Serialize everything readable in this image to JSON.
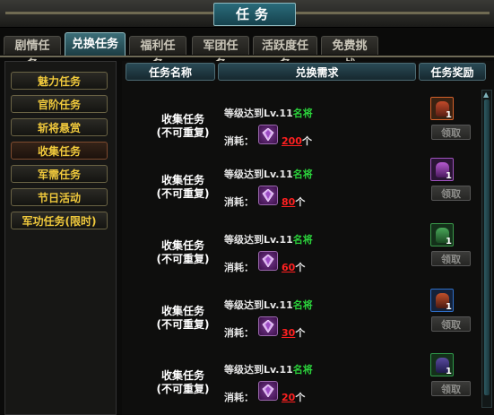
{
  "window": {
    "title": "任务"
  },
  "tabs": [
    {
      "label": "剧情任务",
      "active": false
    },
    {
      "label": "兑换任务",
      "active": true
    },
    {
      "label": "福利任务",
      "active": false
    },
    {
      "label": "军团任务",
      "active": false
    },
    {
      "label": "活跃度任务",
      "active": false
    },
    {
      "label": "免费挑战",
      "active": false
    }
  ],
  "sidebar": {
    "items": [
      {
        "label": "魅力任务",
        "active": false
      },
      {
        "label": "官阶任务",
        "active": false
      },
      {
        "label": "斩将悬赏",
        "active": false
      },
      {
        "label": "收集任务",
        "active": true
      },
      {
        "label": "军需任务",
        "active": false
      },
      {
        "label": "节日活动",
        "active": false
      },
      {
        "label": "军功任务(限时)",
        "active": false
      }
    ]
  },
  "table": {
    "headers": {
      "name": "任务名称",
      "requirement": "兑换需求",
      "reward": "任务奖励"
    },
    "rows": [
      {
        "name": "收集任务",
        "sub": "(不可重复)",
        "req_prefix": "等级达到Lv.11",
        "req_green": "名将",
        "cost_label": "消耗：",
        "cost_value": "200",
        "cost_unit": "个",
        "reward_count": "1",
        "claim_label": "领取",
        "reward_color": "#d5612a"
      },
      {
        "name": "收集任务",
        "sub": "(不可重复)",
        "req_prefix": "等级达到Lv.11",
        "req_green": "名将",
        "cost_label": "消耗：",
        "cost_value": "80",
        "cost_unit": "个",
        "reward_count": "1",
        "claim_label": "领取",
        "reward_color": "#a052c0"
      },
      {
        "name": "收集任务",
        "sub": "(不可重复)",
        "req_prefix": "等级达到Lv.11",
        "req_green": "名将",
        "cost_label": "消耗：",
        "cost_value": "60",
        "cost_unit": "个",
        "reward_count": "1",
        "claim_label": "领取",
        "reward_color": "#3a9a4a"
      },
      {
        "name": "收集任务",
        "sub": "(不可重复)",
        "req_prefix": "等级达到Lv.11",
        "req_green": "名将",
        "cost_label": "消耗：",
        "cost_value": "30",
        "cost_unit": "个",
        "reward_count": "1",
        "claim_label": "领取",
        "reward_color": "#2f6fc8"
      },
      {
        "name": "收集任务",
        "sub": "(不可重复)",
        "req_prefix": "等级达到Lv.11",
        "req_green": "名将",
        "cost_label": "消耗：",
        "cost_value": "20",
        "cost_unit": "个",
        "reward_count": "1",
        "claim_label": "领取",
        "reward_color": "#2f9a4a"
      }
    ]
  }
}
